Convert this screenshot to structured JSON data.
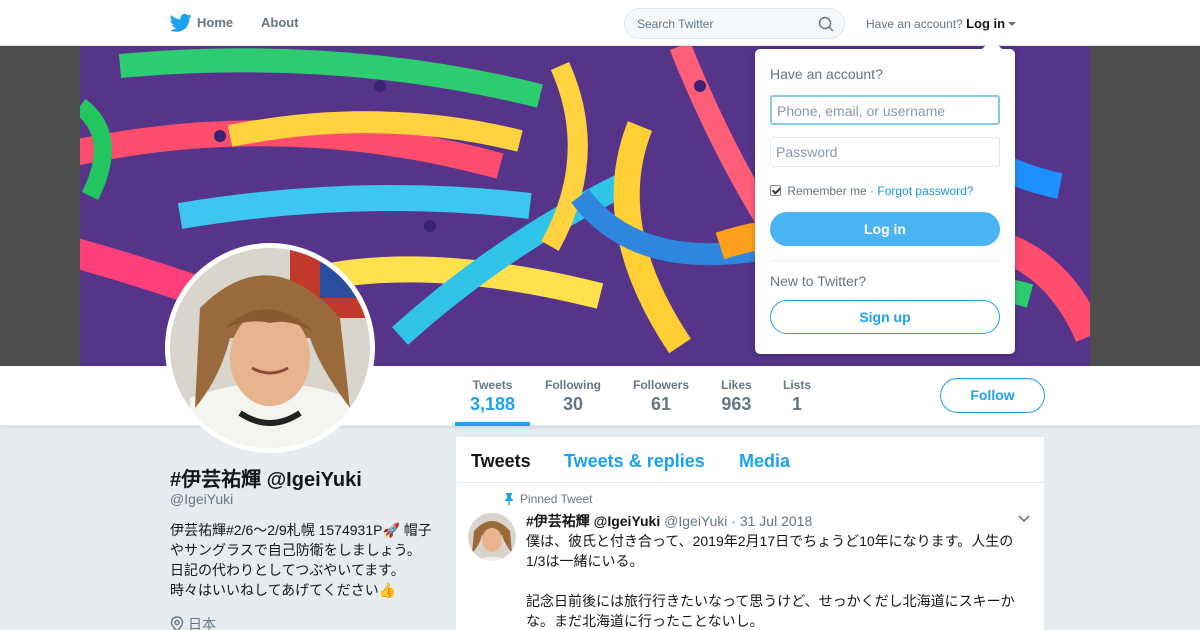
{
  "nav": {
    "home_label": "Home",
    "about_label": "About",
    "search_placeholder": "Search Twitter",
    "have_account": "Have an account?",
    "login_label": "Log in"
  },
  "profile": {
    "name": "#伊芸祐輝 @IgeiYuki",
    "handle": "@IgeiYuki",
    "bio": "伊芸祐輝#2/6〜2/9札幌 1574931P🚀 帽子やサングラスで自己防衛をしましょう。 日記の代わりとしてつぶやいてます。時々はいいねしてあげてください👍",
    "location": "日本"
  },
  "stats": [
    {
      "label": "Tweets",
      "value": "3,188",
      "active": true
    },
    {
      "label": "Following",
      "value": "30",
      "active": false
    },
    {
      "label": "Followers",
      "value": "61",
      "active": false
    },
    {
      "label": "Likes",
      "value": "963",
      "active": false
    },
    {
      "label": "Lists",
      "value": "1",
      "active": false
    }
  ],
  "follow_label": "Follow",
  "timeline": {
    "tabs": [
      "Tweets",
      "Tweets & replies",
      "Media"
    ],
    "pinned_label": "Pinned Tweet",
    "tweet": {
      "author": "#伊芸祐輝 @IgeiYuki",
      "handle": "@IgeiYuki",
      "date": "· 31 Jul 2018",
      "paragraph1": "僕は、彼氏と付き合って、2019年2月17日でちょうど10年になります。人生の1/3は一緒にいる。",
      "paragraph2": "記念日前後には旅行行きたいなって思うけど、せっかくだし北海道にスキーかな。まだ北海道に行ったことないし。"
    }
  },
  "login_dropdown": {
    "title": "Have an account?",
    "username_placeholder": "Phone, email, or username",
    "password_placeholder": "Password",
    "remember_me": "Remember me",
    "separator": " · ",
    "forgot_password": "Forgot password?",
    "login_button": "Log in",
    "new_to_twitter": "New to Twitter?",
    "signup_button": "Sign up"
  },
  "colors": {
    "accent": "#1da1f2",
    "login_button": "#4ab3f4",
    "background": "#e6ecf0"
  },
  "icons": [
    "twitter-bird-icon",
    "search-icon",
    "caret-down-icon",
    "location-pin-icon",
    "pin-icon",
    "chevron-down-icon"
  ]
}
